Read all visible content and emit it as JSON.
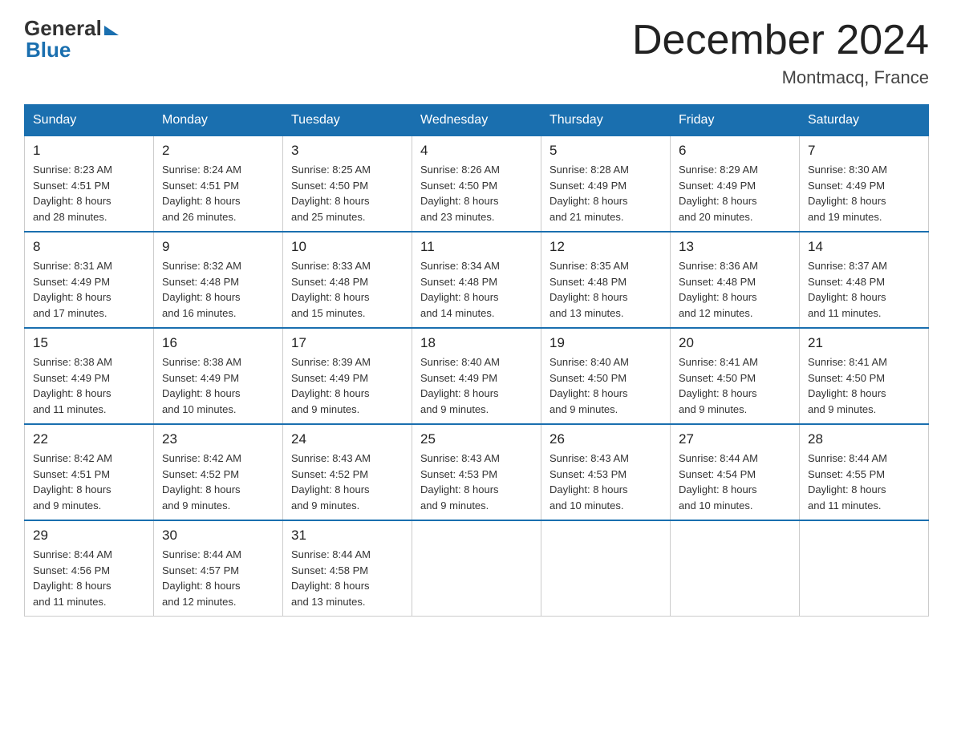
{
  "logo": {
    "general": "General",
    "blue": "Blue"
  },
  "title": "December 2024",
  "location": "Montmacq, France",
  "days_of_week": [
    "Sunday",
    "Monday",
    "Tuesday",
    "Wednesday",
    "Thursday",
    "Friday",
    "Saturday"
  ],
  "weeks": [
    [
      {
        "day": "1",
        "sunrise": "8:23 AM",
        "sunset": "4:51 PM",
        "daylight": "8 hours and 28 minutes."
      },
      {
        "day": "2",
        "sunrise": "8:24 AM",
        "sunset": "4:51 PM",
        "daylight": "8 hours and 26 minutes."
      },
      {
        "day": "3",
        "sunrise": "8:25 AM",
        "sunset": "4:50 PM",
        "daylight": "8 hours and 25 minutes."
      },
      {
        "day": "4",
        "sunrise": "8:26 AM",
        "sunset": "4:50 PM",
        "daylight": "8 hours and 23 minutes."
      },
      {
        "day": "5",
        "sunrise": "8:28 AM",
        "sunset": "4:49 PM",
        "daylight": "8 hours and 21 minutes."
      },
      {
        "day": "6",
        "sunrise": "8:29 AM",
        "sunset": "4:49 PM",
        "daylight": "8 hours and 20 minutes."
      },
      {
        "day": "7",
        "sunrise": "8:30 AM",
        "sunset": "4:49 PM",
        "daylight": "8 hours and 19 minutes."
      }
    ],
    [
      {
        "day": "8",
        "sunrise": "8:31 AM",
        "sunset": "4:49 PM",
        "daylight": "8 hours and 17 minutes."
      },
      {
        "day": "9",
        "sunrise": "8:32 AM",
        "sunset": "4:48 PM",
        "daylight": "8 hours and 16 minutes."
      },
      {
        "day": "10",
        "sunrise": "8:33 AM",
        "sunset": "4:48 PM",
        "daylight": "8 hours and 15 minutes."
      },
      {
        "day": "11",
        "sunrise": "8:34 AM",
        "sunset": "4:48 PM",
        "daylight": "8 hours and 14 minutes."
      },
      {
        "day": "12",
        "sunrise": "8:35 AM",
        "sunset": "4:48 PM",
        "daylight": "8 hours and 13 minutes."
      },
      {
        "day": "13",
        "sunrise": "8:36 AM",
        "sunset": "4:48 PM",
        "daylight": "8 hours and 12 minutes."
      },
      {
        "day": "14",
        "sunrise": "8:37 AM",
        "sunset": "4:48 PM",
        "daylight": "8 hours and 11 minutes."
      }
    ],
    [
      {
        "day": "15",
        "sunrise": "8:38 AM",
        "sunset": "4:49 PM",
        "daylight": "8 hours and 11 minutes."
      },
      {
        "day": "16",
        "sunrise": "8:38 AM",
        "sunset": "4:49 PM",
        "daylight": "8 hours and 10 minutes."
      },
      {
        "day": "17",
        "sunrise": "8:39 AM",
        "sunset": "4:49 PM",
        "daylight": "8 hours and 9 minutes."
      },
      {
        "day": "18",
        "sunrise": "8:40 AM",
        "sunset": "4:49 PM",
        "daylight": "8 hours and 9 minutes."
      },
      {
        "day": "19",
        "sunrise": "8:40 AM",
        "sunset": "4:50 PM",
        "daylight": "8 hours and 9 minutes."
      },
      {
        "day": "20",
        "sunrise": "8:41 AM",
        "sunset": "4:50 PM",
        "daylight": "8 hours and 9 minutes."
      },
      {
        "day": "21",
        "sunrise": "8:41 AM",
        "sunset": "4:50 PM",
        "daylight": "8 hours and 9 minutes."
      }
    ],
    [
      {
        "day": "22",
        "sunrise": "8:42 AM",
        "sunset": "4:51 PM",
        "daylight": "8 hours and 9 minutes."
      },
      {
        "day": "23",
        "sunrise": "8:42 AM",
        "sunset": "4:52 PM",
        "daylight": "8 hours and 9 minutes."
      },
      {
        "day": "24",
        "sunrise": "8:43 AM",
        "sunset": "4:52 PM",
        "daylight": "8 hours and 9 minutes."
      },
      {
        "day": "25",
        "sunrise": "8:43 AM",
        "sunset": "4:53 PM",
        "daylight": "8 hours and 9 minutes."
      },
      {
        "day": "26",
        "sunrise": "8:43 AM",
        "sunset": "4:53 PM",
        "daylight": "8 hours and 10 minutes."
      },
      {
        "day": "27",
        "sunrise": "8:44 AM",
        "sunset": "4:54 PM",
        "daylight": "8 hours and 10 minutes."
      },
      {
        "day": "28",
        "sunrise": "8:44 AM",
        "sunset": "4:55 PM",
        "daylight": "8 hours and 11 minutes."
      }
    ],
    [
      {
        "day": "29",
        "sunrise": "8:44 AM",
        "sunset": "4:56 PM",
        "daylight": "8 hours and 11 minutes."
      },
      {
        "day": "30",
        "sunrise": "8:44 AM",
        "sunset": "4:57 PM",
        "daylight": "8 hours and 12 minutes."
      },
      {
        "day": "31",
        "sunrise": "8:44 AM",
        "sunset": "4:58 PM",
        "daylight": "8 hours and 13 minutes."
      },
      null,
      null,
      null,
      null
    ]
  ],
  "labels": {
    "sunrise": "Sunrise:",
    "sunset": "Sunset:",
    "daylight": "Daylight:"
  }
}
